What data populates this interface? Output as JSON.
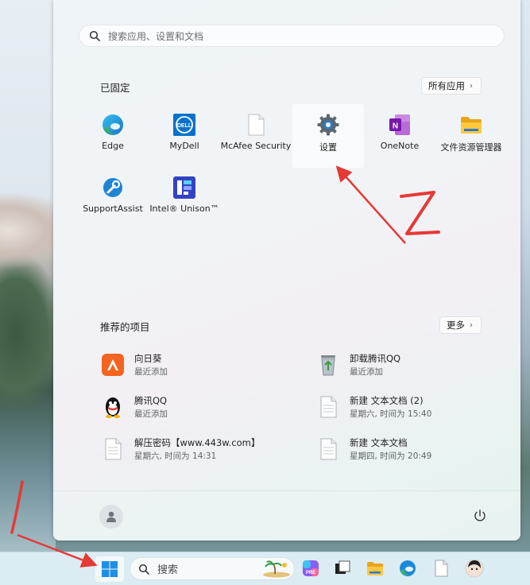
{
  "start_menu": {
    "search_placeholder": "搜索应用、设置和文档",
    "pinned_title": "已固定",
    "all_apps_label": "所有应用",
    "pinned_apps": [
      {
        "label": "Edge",
        "icon": "edge-icon"
      },
      {
        "label": "MyDell",
        "icon": "mydell-icon"
      },
      {
        "label": "McAfee Security",
        "icon": "blank-document-icon"
      },
      {
        "label": "设置",
        "icon": "settings-gear-icon"
      },
      {
        "label": "OneNote",
        "icon": "onenote-icon"
      },
      {
        "label": "文件资源管理器",
        "icon": "folder-icon"
      },
      {
        "label": "SupportAssist",
        "icon": "supportassist-icon"
      },
      {
        "label": "Intel® Unison™",
        "icon": "intel-unison-icon"
      }
    ],
    "recommended_title": "推荐的项目",
    "more_label": "更多",
    "recommended": [
      {
        "title": "向日葵",
        "subtitle": "最近添加",
        "icon": "sunflower-icon"
      },
      {
        "title": "卸载腾讯QQ",
        "subtitle": "最近添加",
        "icon": "recycle-bin-icon"
      },
      {
        "title": "腾讯QQ",
        "subtitle": "最近添加",
        "icon": "qq-penguin-icon"
      },
      {
        "title": "新建 文本文档 (2)",
        "subtitle": "星期六, 时间为 15:40",
        "icon": "text-document-icon"
      },
      {
        "title": "解压密码【www.443w.com】",
        "subtitle": "星期六, 时间为 14:31",
        "icon": "text-document-icon"
      },
      {
        "title": "新建 文本文档",
        "subtitle": "星期四, 时间为 20:49",
        "icon": "text-document-icon"
      }
    ]
  },
  "taskbar": {
    "search_label": "搜索"
  },
  "annotations": {
    "mark_1": "1",
    "mark_2": "Z"
  }
}
